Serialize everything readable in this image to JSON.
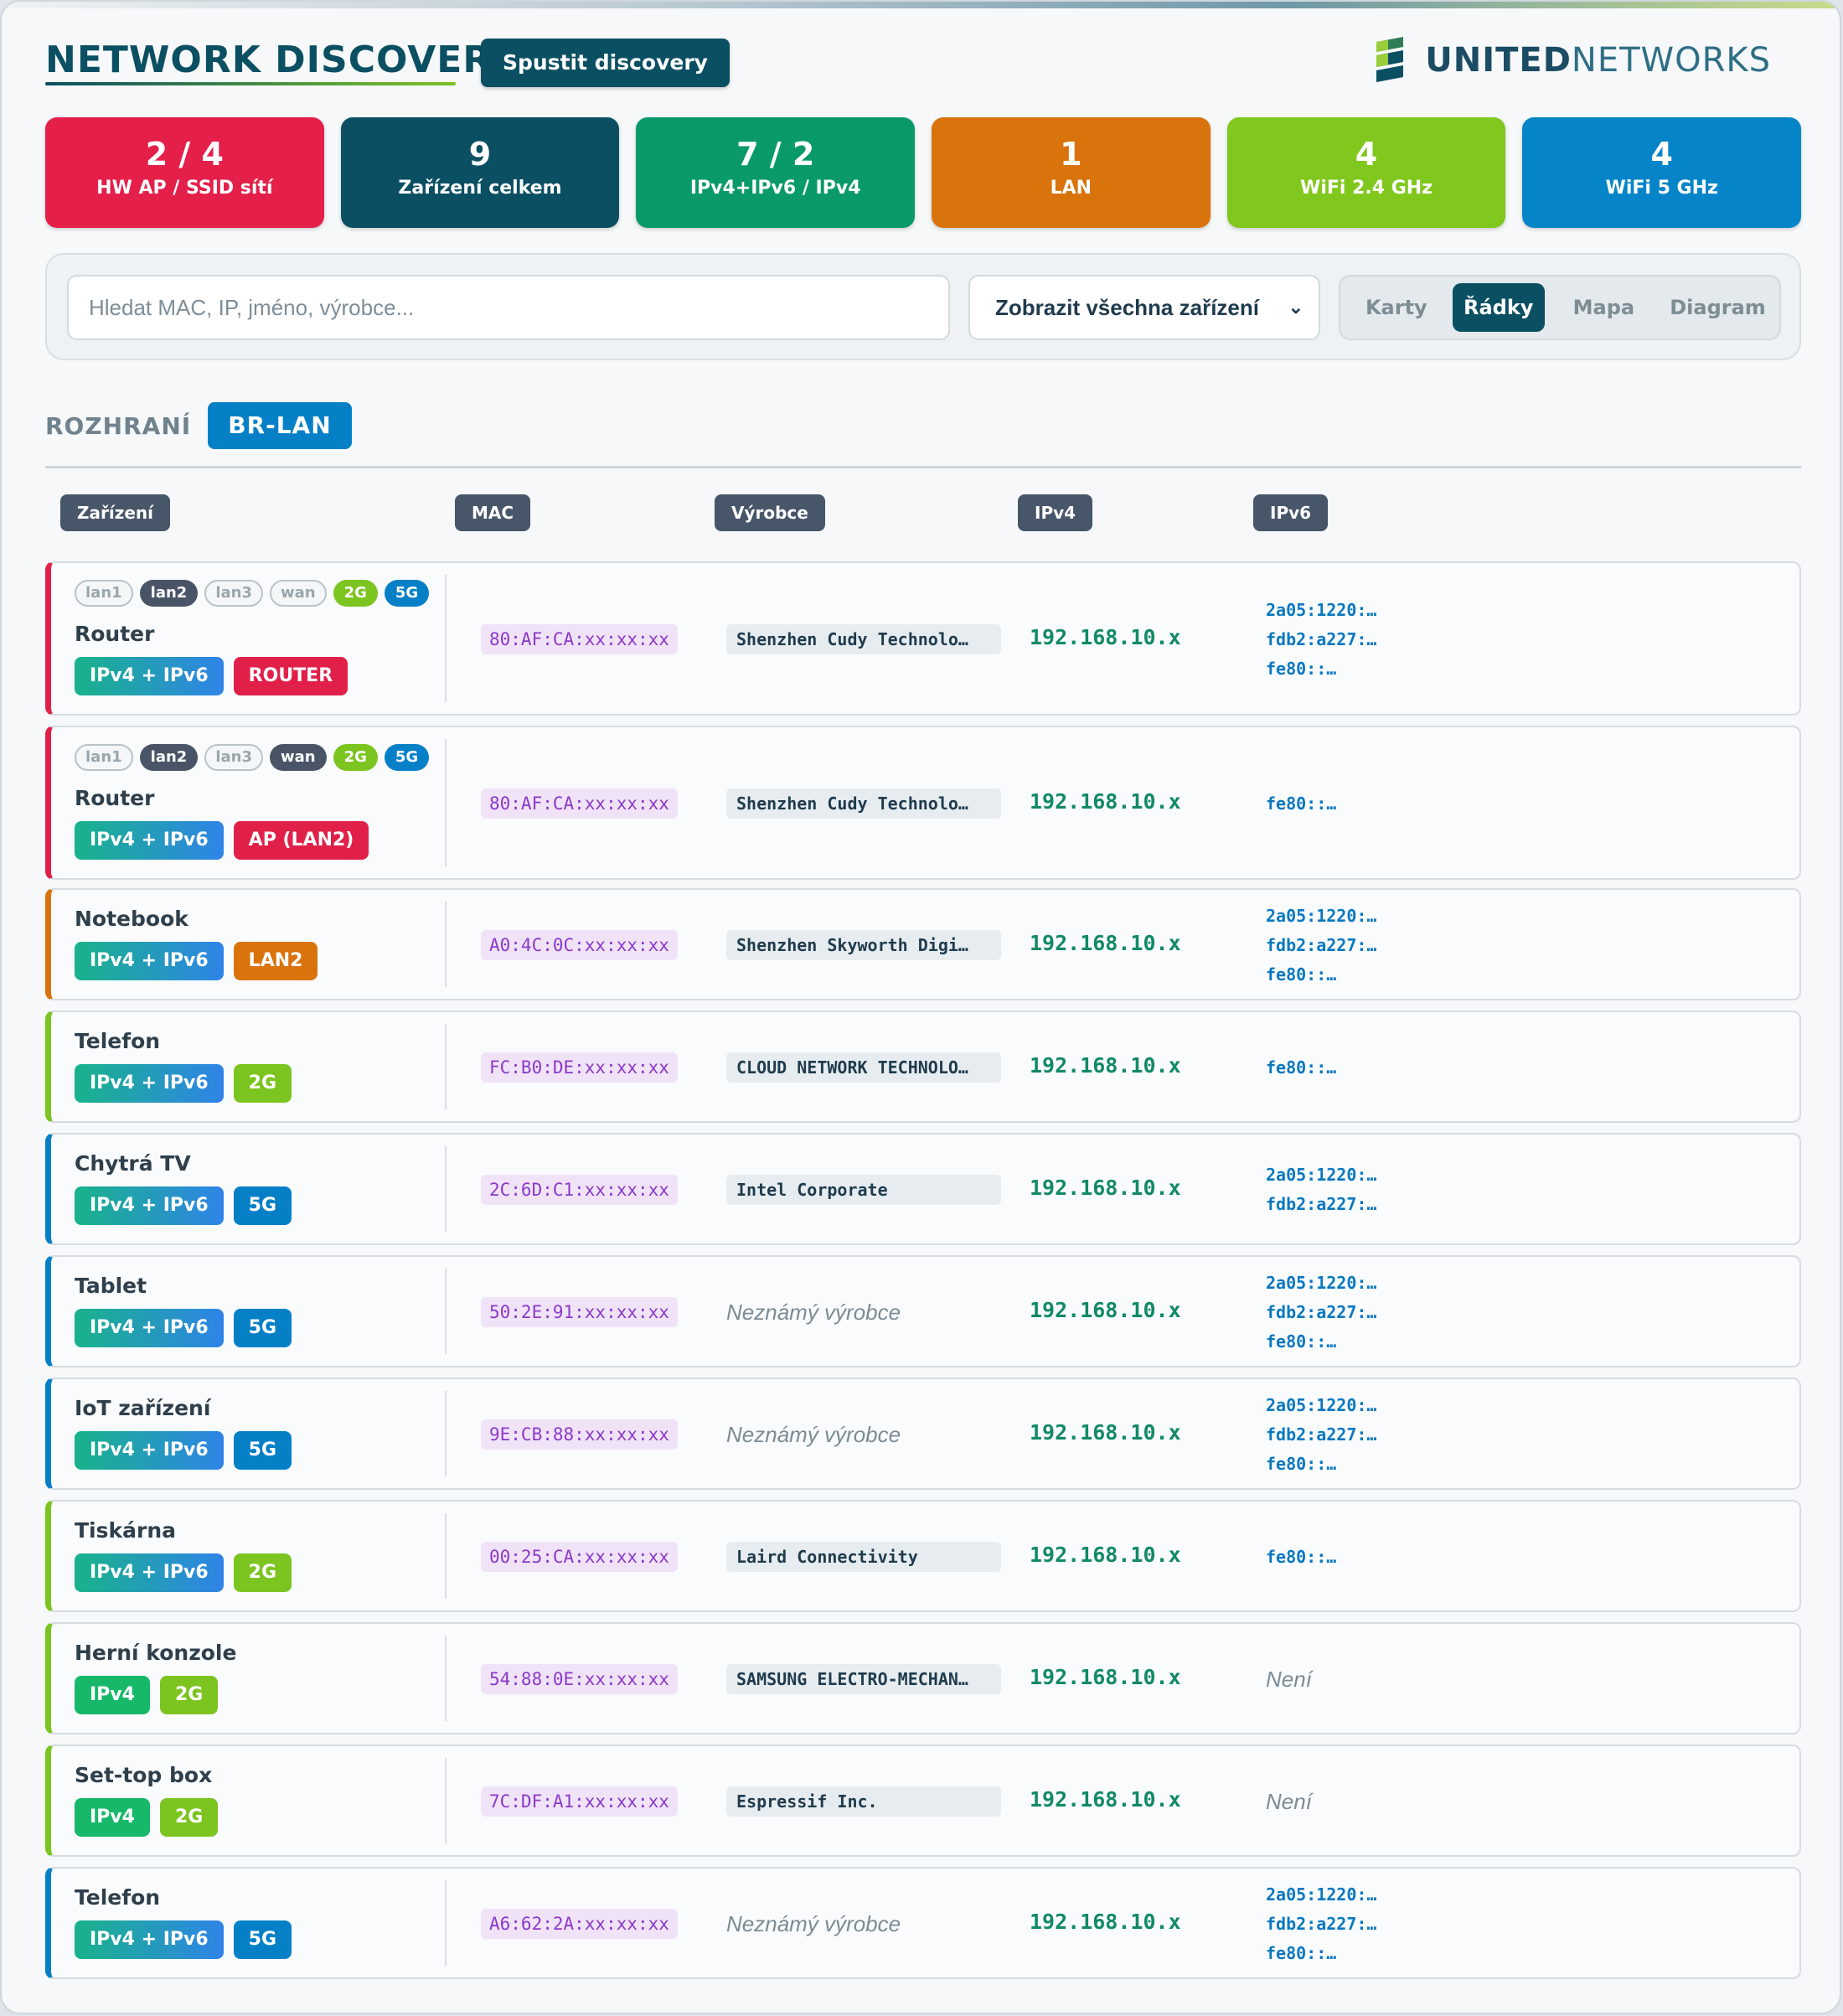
{
  "header": {
    "title": "NETWORK DISCOVERY",
    "run_button": "Spustit discovery",
    "logo_bold": "UNITED",
    "logo_light": "NETWORKS"
  },
  "stats": [
    {
      "value": "2 / 4",
      "label": "HW AP / SSID sítí",
      "color": "#e41f4a"
    },
    {
      "value": "9",
      "label": "Zařízení celkem",
      "color": "#0b4f63"
    },
    {
      "value": "7 / 2",
      "label": "IPv4+IPv6 / IPv4",
      "color": "#0a9a6a"
    },
    {
      "value": "1",
      "label": "LAN",
      "color": "#d9730c"
    },
    {
      "value": "4",
      "label": "WiFi 2.4 GHz",
      "color": "#80c81d"
    },
    {
      "value": "4",
      "label": "WiFi 5 GHz",
      "color": "#0585c8"
    }
  ],
  "filters": {
    "search_placeholder": "Hledat MAC, IP, jméno, výrobce...",
    "select_value": "Zobrazit všechna zařízení",
    "views": [
      "Karty",
      "Řádky",
      "Mapa",
      "Diagram"
    ],
    "active_view": "Řádky"
  },
  "interface": {
    "label": "ROZHRANÍ",
    "name": "BR-LAN"
  },
  "columns": [
    "Zařízení",
    "MAC",
    "Výrobce",
    "IPv4",
    "IPv6"
  ],
  "devices": [
    {
      "name": "Router",
      "border": "#e02049",
      "ports": [
        [
          "lan1",
          "off"
        ],
        [
          "lan2",
          "on"
        ],
        [
          "lan3",
          "off"
        ],
        [
          "wan",
          "off"
        ],
        [
          "2G",
          "g2"
        ],
        [
          "5G",
          "g5"
        ]
      ],
      "proto": "IPv4 + IPv6",
      "tag": "ROUTER",
      "tag_color": "t-red",
      "mac": "80:AF:CA:xx:xx:xx",
      "vendor": "Shenzhen Cudy Technolo…",
      "ipv4": "192.168.10.x",
      "ipv6": [
        "2a05:1220:…",
        "fdb2:a227:…",
        "fe80::…"
      ]
    },
    {
      "name": "Router",
      "border": "#e02049",
      "ports": [
        [
          "lan1",
          "off"
        ],
        [
          "lan2",
          "on"
        ],
        [
          "lan3",
          "off"
        ],
        [
          "wan",
          "on"
        ],
        [
          "2G",
          "g2"
        ],
        [
          "5G",
          "g5"
        ]
      ],
      "proto": "IPv4 + IPv6",
      "tag": "AP (LAN2)",
      "tag_color": "t-red",
      "mac": "80:AF:CA:xx:xx:xx",
      "vendor": "Shenzhen Cudy Technolo…",
      "ipv4": "192.168.10.x",
      "ipv6": [
        "fe80::…"
      ]
    },
    {
      "name": "Notebook",
      "border": "#d9730c",
      "ports": [],
      "proto": "IPv4 + IPv6",
      "tag": "LAN2",
      "tag_color": "t-orange",
      "mac": "A0:4C:0C:xx:xx:xx",
      "vendor": "Shenzhen Skyworth Digi…",
      "ipv4": "192.168.10.x",
      "ipv6": [
        "2a05:1220:…",
        "fdb2:a227:…",
        "fe80::…"
      ]
    },
    {
      "name": "Telefon",
      "border": "#7cc41f",
      "ports": [],
      "proto": "IPv4 + IPv6",
      "tag": "2G",
      "tag_color": "t-2g",
      "mac": "FC:B0:DE:xx:xx:xx",
      "vendor": "CLOUD NETWORK TECHNOLO…",
      "ipv4": "192.168.10.x",
      "ipv6": [
        "fe80::…"
      ]
    },
    {
      "name": "Chytrá TV",
      "border": "#0580c7",
      "ports": [],
      "proto": "IPv4 + IPv6",
      "tag": "5G",
      "tag_color": "t-5g",
      "mac": "2C:6D:C1:xx:xx:xx",
      "vendor": "Intel Corporate",
      "ipv4": "192.168.10.x",
      "ipv6": [
        "2a05:1220:…",
        "fdb2:a227:…"
      ]
    },
    {
      "name": "Tablet",
      "border": "#0580c7",
      "ports": [],
      "proto": "IPv4 + IPv6",
      "tag": "5G",
      "tag_color": "t-5g",
      "mac": "50:2E:91:xx:xx:xx",
      "vendor": "Neznámý výrobce",
      "vendor_unknown": true,
      "ipv4": "192.168.10.x",
      "ipv6": [
        "2a05:1220:…",
        "fdb2:a227:…",
        "fe80::…"
      ]
    },
    {
      "name": "IoT zařízení",
      "border": "#0580c7",
      "ports": [],
      "proto": "IPv4 + IPv6",
      "tag": "5G",
      "tag_color": "t-5g",
      "mac": "9E:CB:88:xx:xx:xx",
      "vendor": "Neznámý výrobce",
      "vendor_unknown": true,
      "ipv4": "192.168.10.x",
      "ipv6": [
        "2a05:1220:…",
        "fdb2:a227:…",
        "fe80::…"
      ]
    },
    {
      "name": "Tiskárna",
      "border": "#7cc41f",
      "ports": [],
      "proto": "IPv4 + IPv6",
      "tag": "2G",
      "tag_color": "t-2g",
      "mac": "00:25:CA:xx:xx:xx",
      "vendor": "Laird Connectivity",
      "ipv4": "192.168.10.x",
      "ipv6": [
        "fe80::…"
      ]
    },
    {
      "name": "Herní konzole",
      "border": "#7cc41f",
      "ports": [],
      "proto": "IPv4",
      "tag": "2G",
      "tag_color": "t-2g",
      "mac": "54:88:0E:xx:xx:xx",
      "vendor": "SAMSUNG ELECTRO-MECHAN…",
      "ipv4": "192.168.10.x",
      "ipv6": [],
      "ipv6_none": "Není"
    },
    {
      "name": "Set-top box",
      "border": "#7cc41f",
      "ports": [],
      "proto": "IPv4",
      "tag": "2G",
      "tag_color": "t-2g",
      "mac": "7C:DF:A1:xx:xx:xx",
      "vendor": "Espressif Inc.",
      "ipv4": "192.168.10.x",
      "ipv6": [],
      "ipv6_none": "Není"
    },
    {
      "name": "Telefon",
      "border": "#0580c7",
      "ports": [],
      "proto": "IPv4 + IPv6",
      "tag": "5G",
      "tag_color": "t-5g",
      "mac": "A6:62:2A:xx:xx:xx",
      "vendor": "Neznámý výrobce",
      "vendor_unknown": true,
      "ipv4": "192.168.10.x",
      "ipv6": [
        "2a05:1220:…",
        "fdb2:a227:…",
        "fe80::…"
      ]
    }
  ]
}
